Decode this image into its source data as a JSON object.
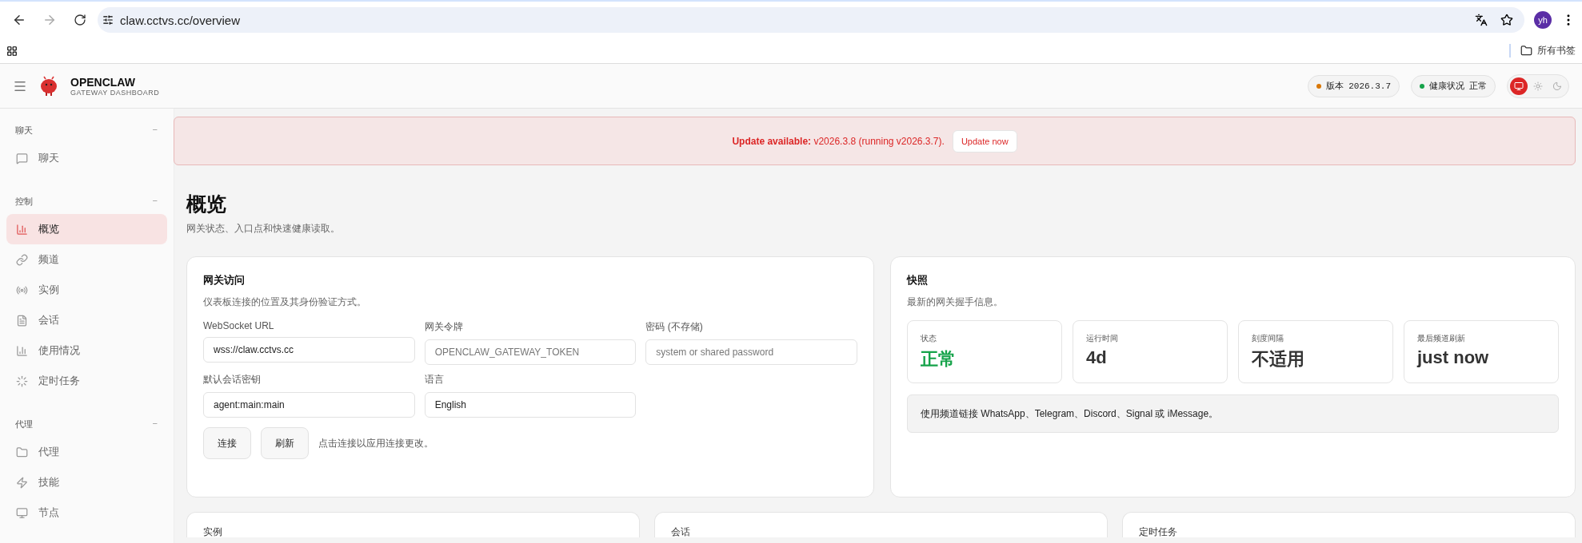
{
  "browser": {
    "url": "claw.cctvs.cc/overview",
    "profile": "yh",
    "bookmarks_folder": "所有书签"
  },
  "header": {
    "brand": "OPENCLAW",
    "subtitle": "GATEWAY DASHBOARD",
    "pills": [
      {
        "label": "版本",
        "value": "2026.3.7",
        "color": "#d97706"
      },
      {
        "label": "健康状况",
        "value": "正常",
        "color": "#16a34a"
      }
    ],
    "theme_modes": [
      {
        "kind": "system",
        "selected": true
      },
      {
        "kind": "light",
        "selected": false
      },
      {
        "kind": "dark",
        "selected": false
      }
    ]
  },
  "sidebar": {
    "groups": [
      {
        "title": "聊天",
        "collapse": "−",
        "items": [
          {
            "label": "聊天",
            "selected": false
          }
        ]
      },
      {
        "title": "控制",
        "collapse": "−",
        "items": [
          {
            "label": "概览",
            "selected": true
          },
          {
            "label": "频道",
            "selected": false
          },
          {
            "label": "实例",
            "selected": false
          },
          {
            "label": "会话",
            "selected": false
          },
          {
            "label": "使用情况",
            "selected": false
          },
          {
            "label": "定时任务",
            "selected": false
          }
        ]
      },
      {
        "title": "代理",
        "collapse": "−",
        "items": [
          {
            "label": "代理",
            "selected": false
          },
          {
            "label": "技能",
            "selected": false
          },
          {
            "label": "节点",
            "selected": false
          }
        ]
      }
    ]
  },
  "banner": {
    "text": "**Update available:** v2026.3.8 (running v2026.3.7).",
    "button": "Update now"
  },
  "page": {
    "title": "概览",
    "subtitle": "网关状态、入口点和快速健康读取。"
  },
  "gateway_access": {
    "title": "网关访问",
    "subtitle": "仪表板连接的位置及其身份验证方式。",
    "fields": [
      {
        "label": "WebSocket URL",
        "value": "wss://claw.cctvs.cc"
      },
      {
        "label": "网关令牌",
        "placeholder": "OPENCLAW_GATEWAY_TOKEN"
      },
      {
        "label": "密码 (不存储)",
        "placeholder": "system or shared password"
      },
      {
        "label": "默认会话密钥",
        "value": "agent:main:main"
      },
      {
        "label": "语言",
        "value": "English"
      }
    ],
    "buttons": [
      "连接",
      "刷新"
    ],
    "hint": "点击连接以应用连接更改。"
  },
  "snapshot": {
    "title": "快照",
    "subtitle": "最新的网关握手信息。",
    "stats": [
      {
        "label": "状态",
        "value": "正常",
        "color": "#16a34a"
      },
      {
        "label": "运行时间",
        "value": "4d",
        "color": "#333333"
      },
      {
        "label": "刻度间隔",
        "value": "不适用",
        "color": "#333333"
      },
      {
        "label": "最后频道刷新",
        "value": "just now",
        "color": "#333333"
      }
    ],
    "note": "使用频道链接 WhatsApp、Telegram、Discord、Signal 或 iMessage。"
  },
  "bottom_cards": [
    {
      "title": "实例"
    },
    {
      "title": "会话"
    },
    {
      "title": "定时任务"
    }
  ]
}
